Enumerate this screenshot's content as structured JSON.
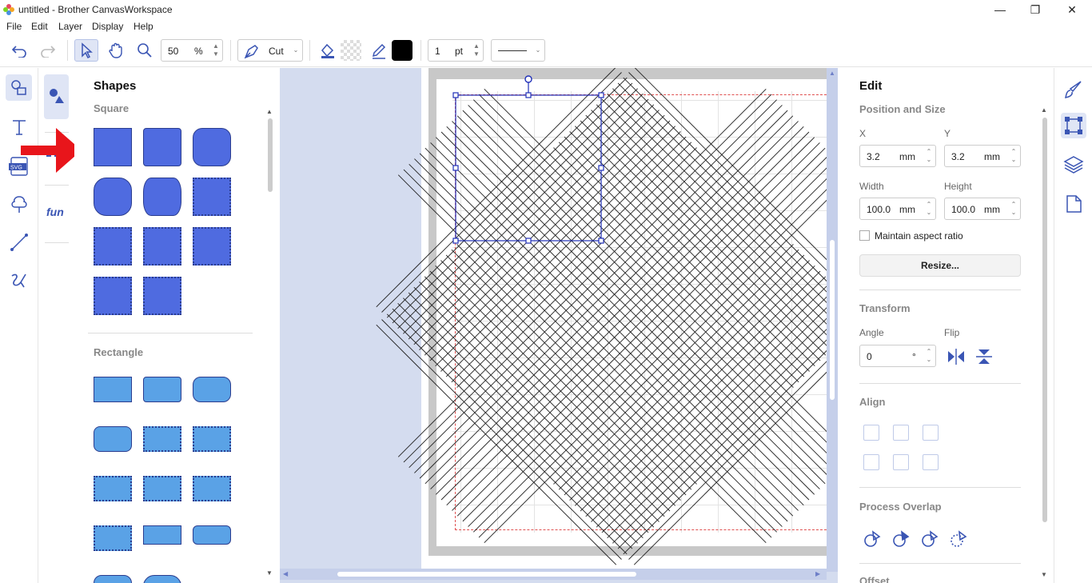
{
  "window": {
    "title": "untitled - Brother CanvasWorkspace"
  },
  "menu": {
    "file": "File",
    "edit": "Edit",
    "layer": "Layer",
    "display": "Display",
    "help": "Help"
  },
  "toolbar": {
    "zoom_value": "50",
    "zoom_unit": "%",
    "mode": "Cut",
    "line_width": "1",
    "line_unit": "pt"
  },
  "shapes_panel": {
    "title": "Shapes",
    "section_square": "Square",
    "section_rectangle": "Rectangle",
    "fun_label": "fun"
  },
  "edit_panel": {
    "title": "Edit",
    "position_size": "Position and Size",
    "x_label": "X",
    "y_label": "Y",
    "x_value": "3.2",
    "y_value": "3.2",
    "width_label": "Width",
    "height_label": "Height",
    "width_value": "100.0",
    "height_value": "100.0",
    "unit": "mm",
    "maintain_aspect": "Maintain aspect ratio",
    "resize": "Resize...",
    "transform": "Transform",
    "angle_label": "Angle",
    "angle_value": "0",
    "angle_unit": "°",
    "flip_label": "Flip",
    "align": "Align",
    "process_overlap": "Process Overlap",
    "offset": "Offset"
  },
  "colors": {
    "shape_fill": "#4f6be0",
    "rect_fill": "#5aa2e6",
    "selection": "#1f2fb8",
    "canvas_bg": "#d4dcef"
  }
}
